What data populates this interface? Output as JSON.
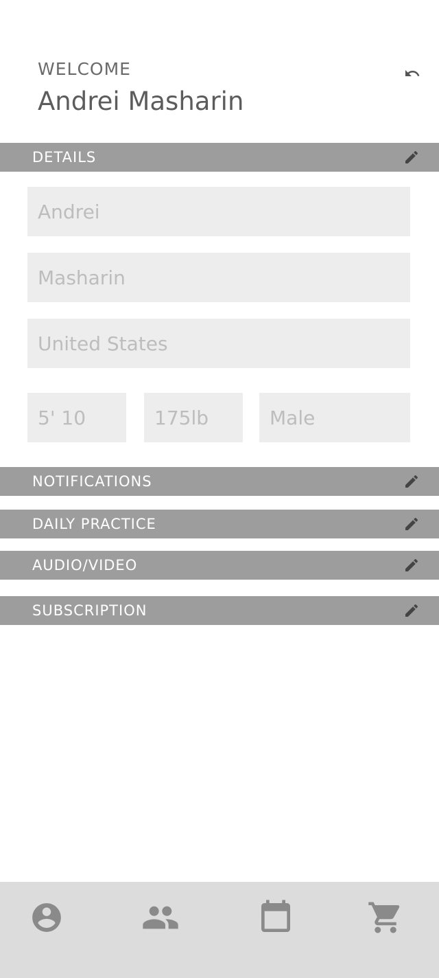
{
  "header": {
    "welcome": "WELCOME",
    "user_name": "Andrei Masharin",
    "undo_icon": "undo-icon"
  },
  "sections": {
    "details": "DETAILS",
    "notifications": "NOTIFICATIONS",
    "daily_practice": "DAILY PRACTICE",
    "audio_video": "AUDIO/VIDEO",
    "subscription": "SUBSCRIPTION",
    "edit_icon": "pencil-icon"
  },
  "details": {
    "first_name": "Andrei",
    "last_name": "Masharin",
    "country": "United States",
    "height": "5' 10",
    "weight": "175lb",
    "gender": "Male"
  },
  "nav": {
    "items": [
      "profile-icon",
      "group-icon",
      "calendar-icon",
      "cart-icon"
    ]
  },
  "colors": {
    "section_bar": "#9d9d9d",
    "field_bg": "#ededed",
    "nav_bg": "#dcdcdc",
    "icon": "#8a8a8a"
  }
}
